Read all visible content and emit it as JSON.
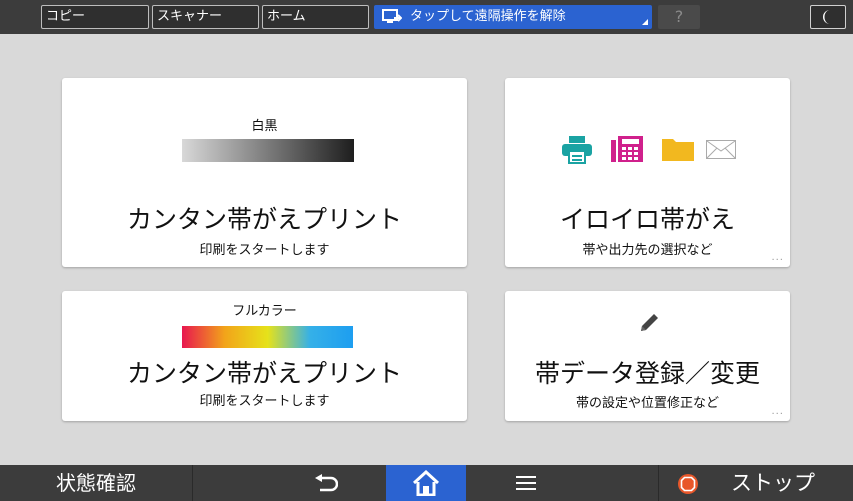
{
  "topbar": {
    "tabs": [
      "コピー",
      "スキャナー",
      "ホーム"
    ],
    "remote_label": "タップして遠隔操作を解除",
    "help_label": "?"
  },
  "cards": {
    "mono_print": {
      "mode": "白黒",
      "title": "カンタン帯がえプリント",
      "subtitle": "印刷をスタートします"
    },
    "various": {
      "title": "イロイロ帯がえ",
      "subtitle": "帯や出力先の選択など",
      "more": "..."
    },
    "color_print": {
      "mode": "フルカラー",
      "title": "カンタン帯がえプリント",
      "subtitle": "印刷をスタートします"
    },
    "register": {
      "title": "帯データ登録／変更",
      "subtitle": "帯の設定や位置修正など",
      "more": "..."
    }
  },
  "bottombar": {
    "status_label": "状態確認",
    "stop_label": "ストップ"
  },
  "colors": {
    "accent": "#2b63d1",
    "printer": "#1aa3a3",
    "fax": "#d0208c",
    "folder": "#f2b81f",
    "stop": "#e8572a"
  },
  "icons": [
    "printer-icon",
    "fax-icon",
    "folder-icon",
    "mail-icon",
    "pencil-icon",
    "back-icon",
    "home-icon",
    "menu-icon",
    "stop-icon",
    "moon-icon",
    "remote-icon"
  ]
}
